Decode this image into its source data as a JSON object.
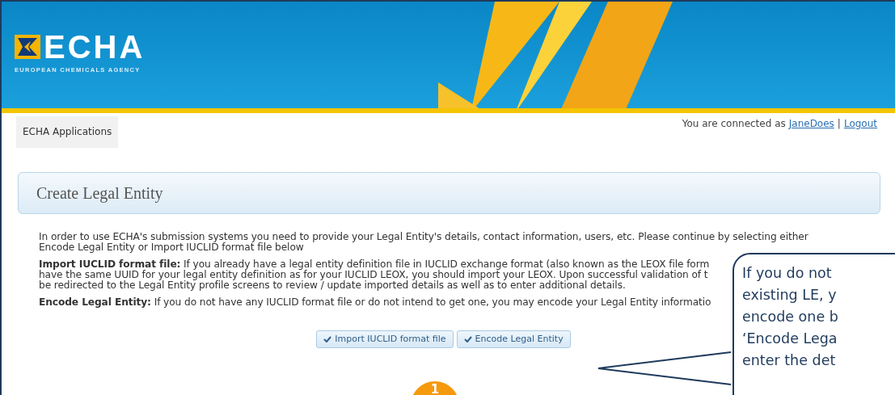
{
  "header": {
    "logo_text": "ECHA",
    "logo_subtitle": "EUROPEAN CHEMICALS AGENCY"
  },
  "nav": {
    "applications_label": "ECHA Applications",
    "user_prefix": "You are connected as",
    "user_link": "JaneDoes",
    "separator": "|",
    "logout_link": "Logout"
  },
  "panel_title": "Create Legal Entity",
  "paragraphs": [
    {
      "lines": [
        "In order to use ECHA's submission systems you need to provide your Legal Entity's details, contact information, users, etc. Please continue by selecting either",
        "Encode Legal Entity or Import IUCLID format file below"
      ]
    },
    {
      "lines": [
        "**Import IUCLID format file:** If you already have a legal entity definition file in IUCLID exchange format (also known as the LEOX file form",
        "have the same UUID for your legal entity definition as for your IUCLID LEOX, you should import your LEOX. Upon successful validation of t",
        "be redirected to the Legal Entity profile screens to review / update imported details as well as to enter additional details."
      ]
    },
    {
      "lines": [
        "**Encode Legal Entity:** If you do not have any IUCLID format file or do not intend to get one, you may encode your Legal Entity informatio"
      ]
    }
  ],
  "buttons": [
    {
      "label": "Import IUCLID format file"
    },
    {
      "label": "Encode Legal Entity"
    }
  ],
  "step_badge": "1",
  "callout": {
    "lines": [
      "If you do not",
      "existing LE, y",
      "encode one b",
      "‘Encode Lega",
      "enter the det"
    ]
  }
}
